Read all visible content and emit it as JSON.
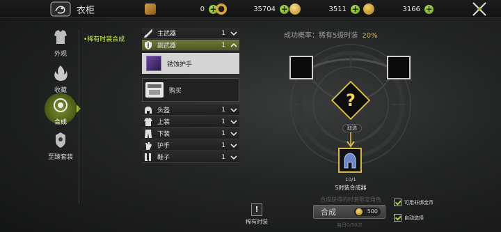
{
  "header": {
    "title": "衣柜",
    "currencies": [
      {
        "icon": "ticket-icon",
        "value": "0",
        "color": "#c8903a"
      },
      {
        "icon": "gold-ring-icon",
        "value": "35704",
        "color": "#d5a73a"
      },
      {
        "icon": "coin-bag-icon",
        "value": "3511",
        "color": "#e3b84c"
      },
      {
        "icon": "gold-coin-icon",
        "value": "3166",
        "color": "#e0a82c"
      }
    ],
    "plus_glyph": "+"
  },
  "nav": {
    "items": [
      {
        "label": "外观",
        "icon": "armor-icon"
      },
      {
        "label": "收藏",
        "icon": "flame-icon"
      },
      {
        "label": "合成",
        "icon": "synthesis-icon",
        "active": true
      },
      {
        "label": "至臻套装",
        "icon": "suit-icon"
      }
    ],
    "subtab": "•稀有时装合成"
  },
  "list": {
    "rows": [
      {
        "label": "主武器",
        "count": "1",
        "icon": "sword-icon",
        "expanded": false
      },
      {
        "label": "副武器",
        "count": "1",
        "icon": "shield-icon",
        "expanded": true
      },
      {
        "label": "头盔",
        "count": "1",
        "icon": "helmet-icon",
        "expanded": false
      },
      {
        "label": "上装",
        "count": "1",
        "icon": "chest-icon",
        "expanded": false
      },
      {
        "label": "下装",
        "count": "1",
        "icon": "pants-icon",
        "expanded": false
      },
      {
        "label": "护手",
        "count": "1",
        "icon": "gauntlet-icon",
        "expanded": false
      },
      {
        "label": "鞋子",
        "count": "1",
        "icon": "boots-icon",
        "expanded": false
      }
    ],
    "selected_item": "锈蚀护手",
    "buy_label": "购买"
  },
  "synth": {
    "rate_label": "成功概率：稀有5级时装",
    "rate_value": "20%",
    "question": "?",
    "pick_label": "取选",
    "result_count": "10/1",
    "result_name": "5时装合成器",
    "hint": "合成获得的时装限定角色",
    "synth_label": "合成",
    "cost": "500",
    "daily": "每日0/50次",
    "check_bind_coin": "可用非绑金币",
    "check_auto": "自动选择"
  },
  "rare_button": {
    "label": "稀有时装",
    "glyph": "!"
  },
  "colors": {
    "accent": "#9cc23a",
    "gold": "#d7b84a"
  }
}
